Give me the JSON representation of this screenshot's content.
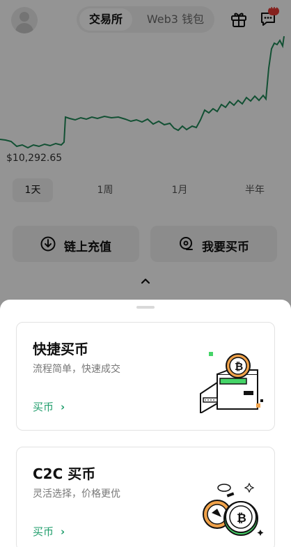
{
  "header": {
    "tabs": [
      {
        "label": "交易所",
        "active": true
      },
      {
        "label": "Web3 钱包",
        "active": false
      }
    ],
    "icons": [
      "avatar",
      "gift-icon",
      "chat-icon"
    ]
  },
  "chart": {
    "price_label": "$10,292.65",
    "line_color": "#1f8a58"
  },
  "ranges": [
    {
      "label": "1天",
      "active": true
    },
    {
      "label": "1周",
      "active": false
    },
    {
      "label": "1月",
      "active": false
    },
    {
      "label": "半年",
      "active": false
    }
  ],
  "actions": {
    "deposit_label": "链上充值",
    "buy_label": "我要买币"
  },
  "sheet": {
    "cards": [
      {
        "title": "快捷买币",
        "subtitle": "流程简单，快速成交",
        "link": "买币"
      },
      {
        "title": "C2C 买币",
        "subtitle": "灵活选择，价格更优",
        "link": "买币"
      }
    ]
  },
  "colors": {
    "accent": "#1f9d6b",
    "badge": "#e53935"
  }
}
